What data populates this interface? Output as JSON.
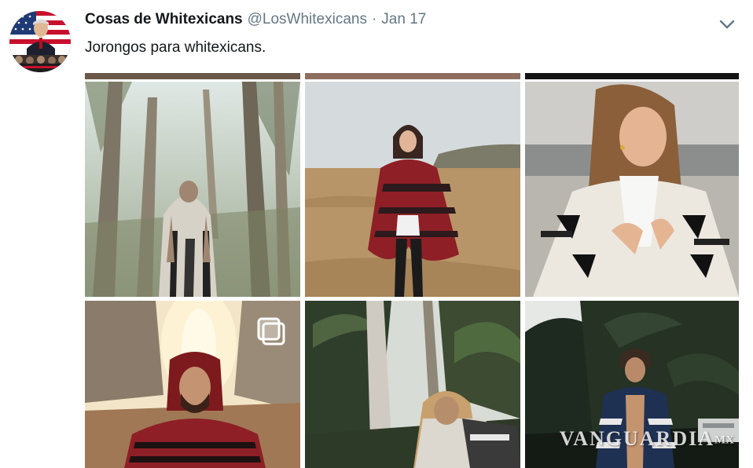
{
  "tweet": {
    "display_name": "Cosas de Whitexicans",
    "handle": "@LosWhitexicans",
    "separator": "·",
    "date": "Jan 17",
    "text": "Jorongos para whitexicans."
  },
  "media": {
    "cells": [
      {
        "name": "photo-forest-poncho",
        "scene": "forest"
      },
      {
        "name": "photo-woman-red-poncho-field",
        "scene": "field"
      },
      {
        "name": "photo-woman-white-poncho-beach",
        "scene": "beach"
      },
      {
        "name": "photo-man-red-poncho-cliffs",
        "scene": "cliffs"
      },
      {
        "name": "photo-man-sitting-jungle",
        "scene": "jungle"
      },
      {
        "name": "photo-man-blue-poncho-trees",
        "scene": "trees"
      }
    ],
    "multi_image_icon": "stacked-squares-icon"
  },
  "watermark": {
    "text": "VANGUARDIA",
    "suffix": "MX"
  },
  "icons": {
    "chevron": "chevron-down-icon",
    "avatar": "flag-avatar"
  },
  "colors": {
    "name": "#14171a",
    "secondary": "#657786"
  }
}
